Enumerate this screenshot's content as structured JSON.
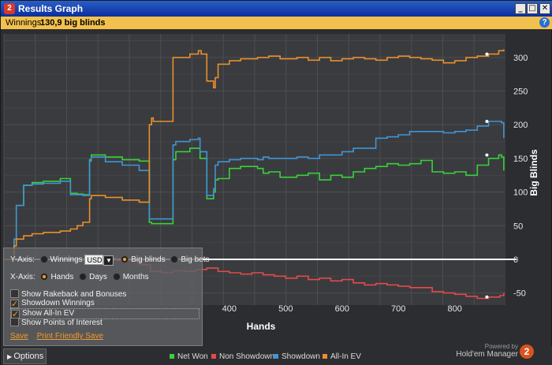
{
  "window": {
    "title": "Results Graph",
    "app_icon": "2",
    "controls": [
      "_",
      "□",
      "✕"
    ]
  },
  "winnings": {
    "label": "Winnings:",
    "value": "130,9 big blinds",
    "help_icon": "?"
  },
  "chart_data": {
    "type": "line",
    "xlabel": "Hands",
    "ylabel": "Big Blinds",
    "xlim": [
      0,
      890
    ],
    "ylim": [
      -68,
      335
    ],
    "xticks": [
      400,
      500,
      600,
      700,
      800
    ],
    "yticks": [
      -50,
      0,
      50,
      100,
      150,
      200,
      250,
      300
    ],
    "grid": true,
    "legend_position": "bottom",
    "series": [
      {
        "name": "Net Won",
        "color": "#38d13a",
        "x": [
          0,
          18,
          22,
          35,
          50,
          70,
          100,
          118,
          130,
          140,
          152,
          155,
          180,
          210,
          240,
          258,
          262,
          300,
          305,
          330,
          345,
          348,
          360,
          372,
          375,
          380,
          400,
          420,
          450,
          460,
          470,
          490,
          520,
          540,
          560,
          580,
          600,
          620,
          640,
          660,
          680,
          700,
          720,
          740,
          760,
          780,
          800,
          820,
          840,
          860,
          878,
          883,
          887
        ],
        "y": [
          0,
          30,
          80,
          110,
          114,
          116,
          120,
          98,
          97,
          96,
          148,
          155,
          152,
          148,
          146,
          55,
          53,
          148,
          160,
          165,
          165,
          150,
          90,
          100,
          118,
          120,
          135,
          138,
          135,
          128,
          130,
          122,
          125,
          128,
          118,
          125,
          122,
          130,
          135,
          138,
          142,
          140,
          142,
          147,
          130,
          128,
          130,
          125,
          140,
          150,
          155,
          152,
          132
        ]
      },
      {
        "name": "Non Showdown",
        "color": "#e34a4a",
        "x": [
          150,
          180,
          200,
          240,
          260,
          280,
          300,
          320,
          340,
          360,
          380,
          400,
          420,
          440,
          460,
          480,
          500,
          520,
          540,
          560,
          580,
          600,
          620,
          640,
          660,
          680,
          700,
          720,
          740,
          760,
          780,
          800,
          820,
          840,
          860,
          880,
          887
        ],
        "y": [
          3,
          2,
          -2,
          -8,
          -18,
          -20,
          -17,
          -18,
          -15,
          -13,
          -18,
          -20,
          -22,
          -20,
          -23,
          -25,
          -28,
          -25,
          -30,
          -28,
          -32,
          -30,
          -35,
          -38,
          -36,
          -38,
          -40,
          -42,
          -42,
          -48,
          -50,
          -52,
          -55,
          -58,
          -56,
          -54,
          -50
        ]
      },
      {
        "name": "Showdown",
        "color": "#3f95d6",
        "x": [
          0,
          18,
          22,
          35,
          50,
          70,
          100,
          118,
          130,
          140,
          152,
          155,
          180,
          210,
          240,
          258,
          262,
          300,
          305,
          330,
          345,
          348,
          360,
          372,
          375,
          380,
          400,
          420,
          450,
          460,
          470,
          490,
          520,
          540,
          560,
          580,
          600,
          620,
          640,
          660,
          680,
          700,
          720,
          740,
          760,
          780,
          800,
          820,
          840,
          860,
          878,
          883,
          887
        ],
        "y": [
          0,
          30,
          80,
          110,
          112,
          113,
          116,
          96,
          96,
          95,
          146,
          152,
          145,
          140,
          132,
          60,
          60,
          170,
          175,
          178,
          180,
          160,
          95,
          105,
          140,
          145,
          148,
          150,
          148,
          152,
          150,
          150,
          152,
          150,
          155,
          155,
          160,
          165,
          165,
          180,
          182,
          185,
          190,
          190,
          190,
          188,
          190,
          192,
          198,
          205,
          205,
          203,
          180
        ]
      },
      {
        "name": "All-In EV",
        "color": "#e8902e",
        "x": [
          0,
          18,
          22,
          35,
          50,
          70,
          100,
          118,
          130,
          140,
          152,
          155,
          180,
          210,
          240,
          258,
          262,
          265,
          298,
          300,
          330,
          345,
          350,
          360,
          372,
          375,
          380,
          400,
          420,
          450,
          460,
          470,
          490,
          520,
          540,
          560,
          580,
          600,
          620,
          640,
          660,
          680,
          700,
          720,
          740,
          760,
          780,
          800,
          820,
          840,
          860,
          878,
          887
        ],
        "y": [
          0,
          20,
          30,
          35,
          38,
          40,
          42,
          45,
          50,
          55,
          90,
          95,
          92,
          88,
          85,
          200,
          210,
          205,
          205,
          300,
          305,
          310,
          305,
          265,
          255,
          270,
          290,
          295,
          298,
          300,
          300,
          302,
          298,
          300,
          296,
          300,
          295,
          298,
          300,
          298,
          296,
          300,
          302,
          300,
          298,
          296,
          292,
          295,
          300,
          302,
          305,
          310,
          312
        ]
      }
    ]
  },
  "options": {
    "yaxis": {
      "label": "Y-Axis:",
      "winnings": "Winnings",
      "currency": "USD",
      "big_blinds": "Big blinds",
      "big_bets": "Big bets",
      "selected": "big_blinds"
    },
    "xaxis": {
      "label": "X-Axis:",
      "hands": "Hands",
      "days": "Days",
      "months": "Months",
      "selected": "hands"
    },
    "checks": [
      {
        "label": "Show Rakeback and Bonuses",
        "checked": false
      },
      {
        "label": "Showdown Winnings",
        "checked": true
      },
      {
        "label": "Show All-In EV",
        "checked": true
      },
      {
        "label": "Show Points of Interest",
        "checked": false
      }
    ],
    "save": "Save",
    "print": "Print Friendly Save"
  },
  "bottom": {
    "options_tab": "Options",
    "legend": [
      {
        "label": "Net Won",
        "color": "#38d13a"
      },
      {
        "label": "Non Showdown",
        "color": "#e34a4a"
      },
      {
        "label": "Showdown",
        "color": "#3f95d6"
      },
      {
        "label": "All-In EV",
        "color": "#e8902e"
      }
    ],
    "powered_by": "Powered by",
    "brand": "Hold'em Manager",
    "logo": "2"
  }
}
